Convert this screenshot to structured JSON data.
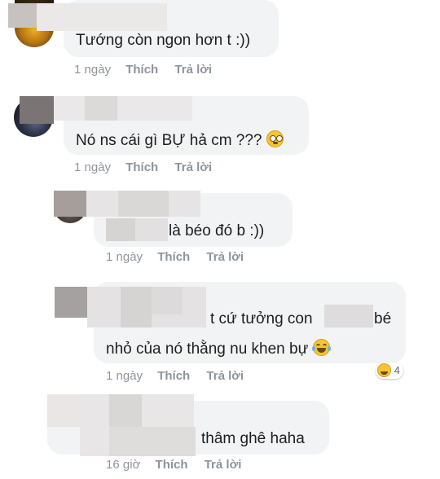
{
  "comments": [
    {
      "text": "Tướng còn ngon hơn t :))",
      "time": "1 ngày",
      "like": "Thích",
      "reply": "Trả lời"
    },
    {
      "text": "Nó ns cái gì BỰ hả cm ???",
      "time": "1 ngày",
      "like": "Thích",
      "reply": "Trả lời",
      "emoji": "flushed-face-icon"
    },
    {
      "text": "là béo đó b :))",
      "time": "1 ngày",
      "like": "Thích",
      "reply": "Trả lời"
    },
    {
      "text_a": "t cứ tưởng con",
      "text_b": "bé",
      "text_c": "nhỏ của nó thằng nu khen bự",
      "time": "1 ngày",
      "like": "Thích",
      "reply": "Trả lời",
      "emoji": "laughing-tears-icon",
      "reaction_count": "4"
    },
    {
      "text": "thâm ghê haha",
      "time": "16 giờ",
      "like": "Thích",
      "reply": "Trả lời"
    }
  ],
  "colors": {
    "bubble": "#f2f3f5",
    "meta": "#90949c",
    "emoji": "#f7c531"
  }
}
